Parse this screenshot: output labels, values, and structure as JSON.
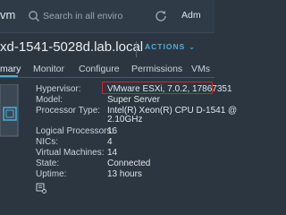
{
  "header": {
    "app_name": "vm",
    "search_placeholder": "Search in all enviro",
    "user": "Adm"
  },
  "object": {
    "title": "xd-1541-5028d.lab.local",
    "actions_label": "ACTIONS"
  },
  "tabs": [
    {
      "label": "mary"
    },
    {
      "label": "Monitor"
    },
    {
      "label": "Configure"
    },
    {
      "label": "Permissions"
    },
    {
      "label": "VMs"
    }
  ],
  "summary": {
    "rows": [
      {
        "label": "Hypervisor:",
        "value": "VMware ESXi, 7.0.2, 17867351"
      },
      {
        "label": "Model:",
        "value": "Super Server"
      },
      {
        "label": "Processor Type:",
        "value": "Intel(R) Xeon(R) CPU D-1541 @"
      },
      {
        "label": "",
        "value": "2.10GHz"
      },
      {
        "label": "Logical Processors:",
        "value": "16"
      },
      {
        "label": "NICs:",
        "value": "4"
      },
      {
        "label": "Virtual Machines:",
        "value": "14"
      },
      {
        "label": "State:",
        "value": "Connected"
      },
      {
        "label": "Uptime:",
        "value": "13 hours"
      }
    ]
  },
  "colors": {
    "accent": "#49afd9",
    "highlight": "#e02020",
    "background": "#2b3640"
  }
}
